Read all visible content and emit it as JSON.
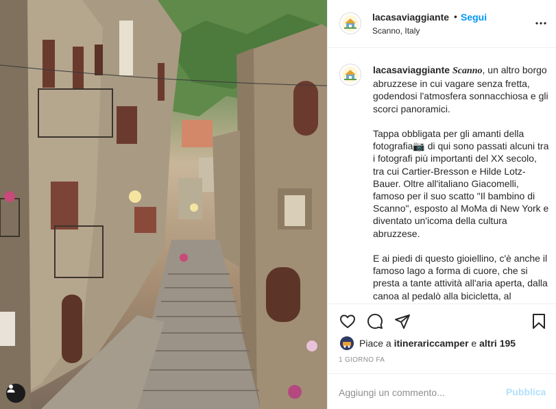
{
  "post": {
    "username": "lacasaviaggiante",
    "separator": "•",
    "follow_label": "Segui",
    "location": "Scanno, Italy",
    "more_icon": "more-horizontal-icon",
    "avatar_icon": "house-logo-icon"
  },
  "caption": {
    "username": "lacasaviaggiante",
    "highlight": "Scanno",
    "text": ", un altro borgo abruzzese in cui vagare senza fretta, godendosi l'atmosfera sonnacchiosa e gli scorci panoramici.\n\nTappa obbligata per gli amanti della fotografia📷 di qui sono passati alcuni tra i fotografi più importanti del XX secolo, tra cui Cartier-Bresson e Hilde Lotz-Bauer. Oltre all'italiano Giacomelli, famoso per il suo scatto \"Il bambino di Scanno\", esposto al MoMa di New York e diventato un'icoma della cultura abruzzese.\n\nE ai piedi di questo gioiellino, c'è anche il famoso lago a forma di cuore, che si presta a tante attività all'aria aperta, dalla canoa al pedalò alla bicicletta, al"
  },
  "actions": {
    "like_icon": "heart-icon",
    "comment_icon": "comment-icon",
    "share_icon": "paper-plane-icon",
    "save_icon": "bookmark-icon"
  },
  "likes": {
    "prefix": "Piace a ",
    "user": "itinerariccamper",
    "connector": " e ",
    "others": "altri 195"
  },
  "timestamp": "1 GIORNO FA",
  "comment": {
    "placeholder": "Aggiungi un commento...",
    "publish_label": "Pubblica"
  },
  "colors": {
    "link_blue": "#0095f6",
    "publish_disabled": "#b2dffc",
    "border": "#efefef",
    "muted": "#8e8e8e"
  }
}
